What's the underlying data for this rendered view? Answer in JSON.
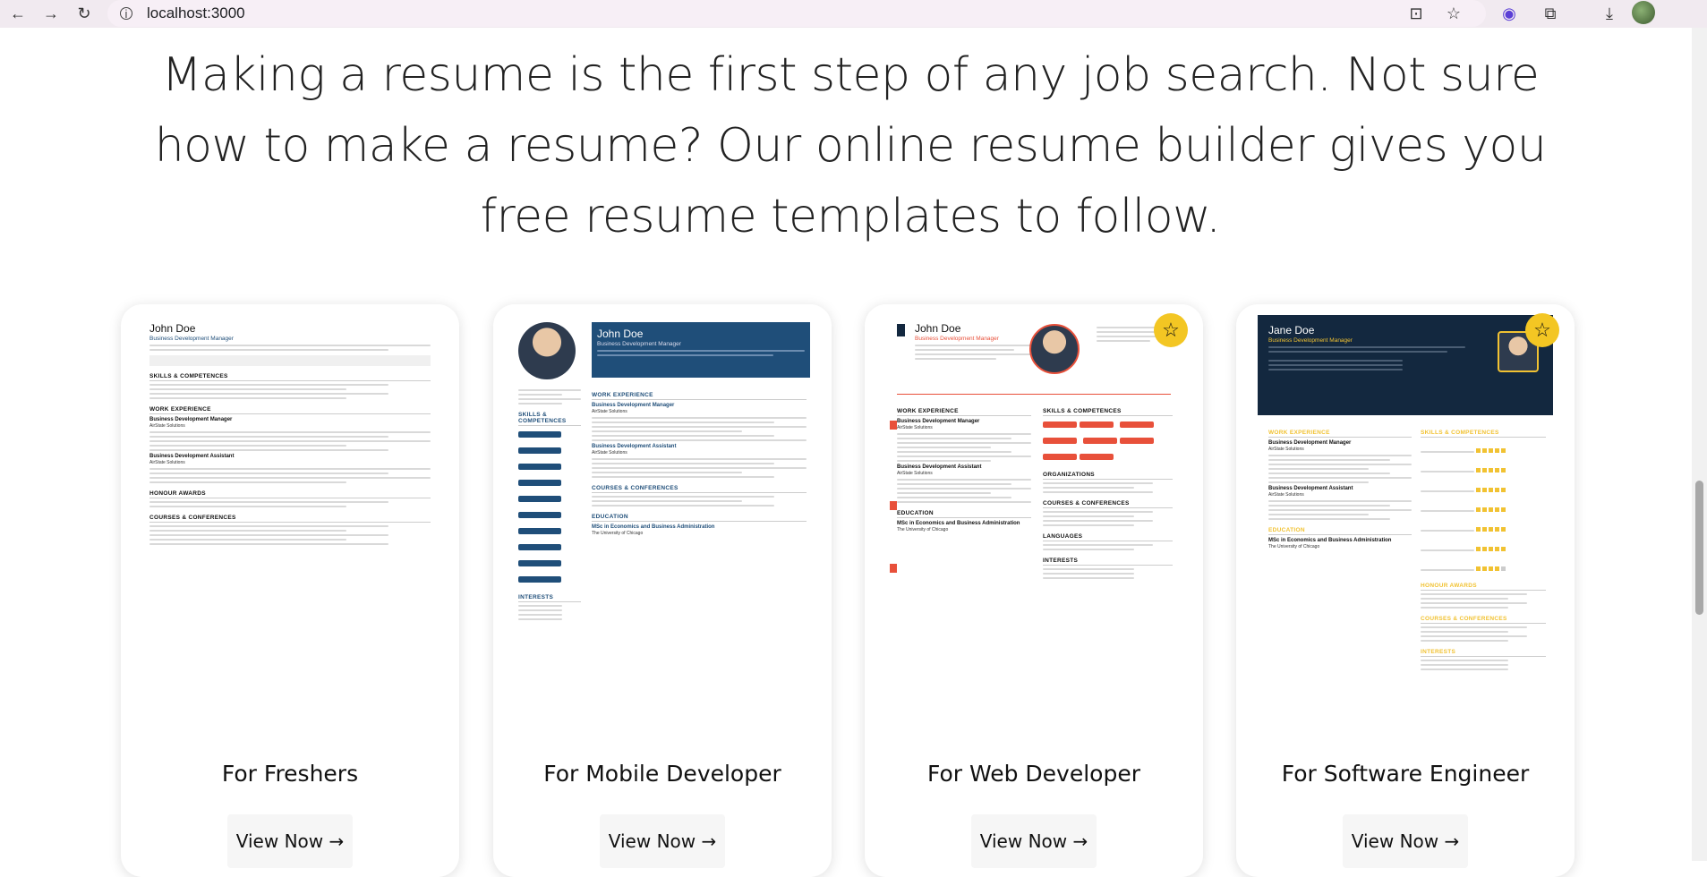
{
  "browser": {
    "url": "localhost:3000",
    "icons": [
      "back-icon",
      "forward-icon",
      "reload-icon",
      "site-info-icon",
      "install-icon",
      "bookmark-star-icon",
      "extension-face-icon",
      "extensions-icon",
      "download-icon",
      "profile-avatar"
    ]
  },
  "hero": {
    "text": "Making a resume is the first step of any job search. Not sure how to make a resume? Our online resume builder gives you free resume templates to follow."
  },
  "cards": [
    {
      "title": "For Freshers",
      "button": "View Now →",
      "resume_name": "John Doe",
      "resume_role": "Business Development Manager",
      "featured": false
    },
    {
      "title": "For Mobile Developer",
      "button": "View Now →",
      "resume_name": "John Doe",
      "resume_role": "Business Development Manager",
      "featured": false
    },
    {
      "title": "For Web Developer",
      "button": "View Now →",
      "resume_name": "John Doe",
      "resume_role": "Business Development Manager",
      "featured": true
    },
    {
      "title": "For Software Engineer",
      "button": "View Now →",
      "resume_name": "Jane Doe",
      "resume_role": "Business Development Manager",
      "featured": true
    }
  ],
  "resume_sections": {
    "skills": "SKILLS & COMPETENCES",
    "work": "WORK EXPERIENCE",
    "honour": "HONOUR AWARDS",
    "courses": "COURSES & CONFERENCES",
    "education": "EDUCATION",
    "interests": "INTERESTS",
    "organizations": "ORGANIZATIONS",
    "languages": "LANGUAGES",
    "job1": "Business Development Manager",
    "job2": "Business Development Assistant",
    "company": "AirState Solutions",
    "degree": "MSc in Economics and Business Administration",
    "school": "The University of Chicago"
  },
  "colors": {
    "accent_blue": "#1f4e79",
    "accent_red": "#e8503a",
    "accent_yellow": "#f1c232",
    "dark_navy": "#13283f",
    "star_yellow": "#f3c623"
  }
}
